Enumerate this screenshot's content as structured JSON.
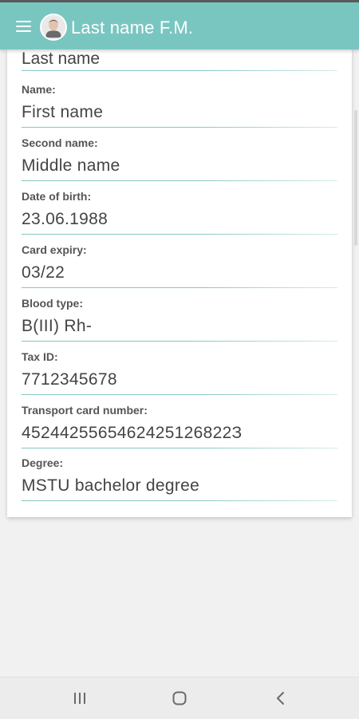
{
  "header": {
    "title": "Last name F.M.",
    "menu_icon": "hamburger-menu-icon",
    "avatar_icon": "user-avatar"
  },
  "colors": {
    "accent": "#79c6c1",
    "underline": "#86c6c2",
    "label": "#555555",
    "value": "#444444"
  },
  "form": {
    "top_field": {
      "value": "Last name"
    },
    "fields": [
      {
        "label": "Name:",
        "value": "First name"
      },
      {
        "label": "Second name:",
        "value": "Middle name"
      },
      {
        "label": "Date of birth:",
        "value": "23.06.1988"
      },
      {
        "label": "Card expiry:",
        "value": "03/22"
      },
      {
        "label": "Blood type:",
        "value": "B(III) Rh-"
      },
      {
        "label": "Tax ID:",
        "value": "7712345678"
      },
      {
        "label": "Transport card number:",
        "value": "4524425565462425126822З"
      },
      {
        "label": "Degree:",
        "value": "MSTU bachelor degree"
      }
    ]
  },
  "navbar": {
    "recents_icon": "recent-apps-icon",
    "home_icon": "home-icon",
    "back_icon": "back-icon"
  }
}
